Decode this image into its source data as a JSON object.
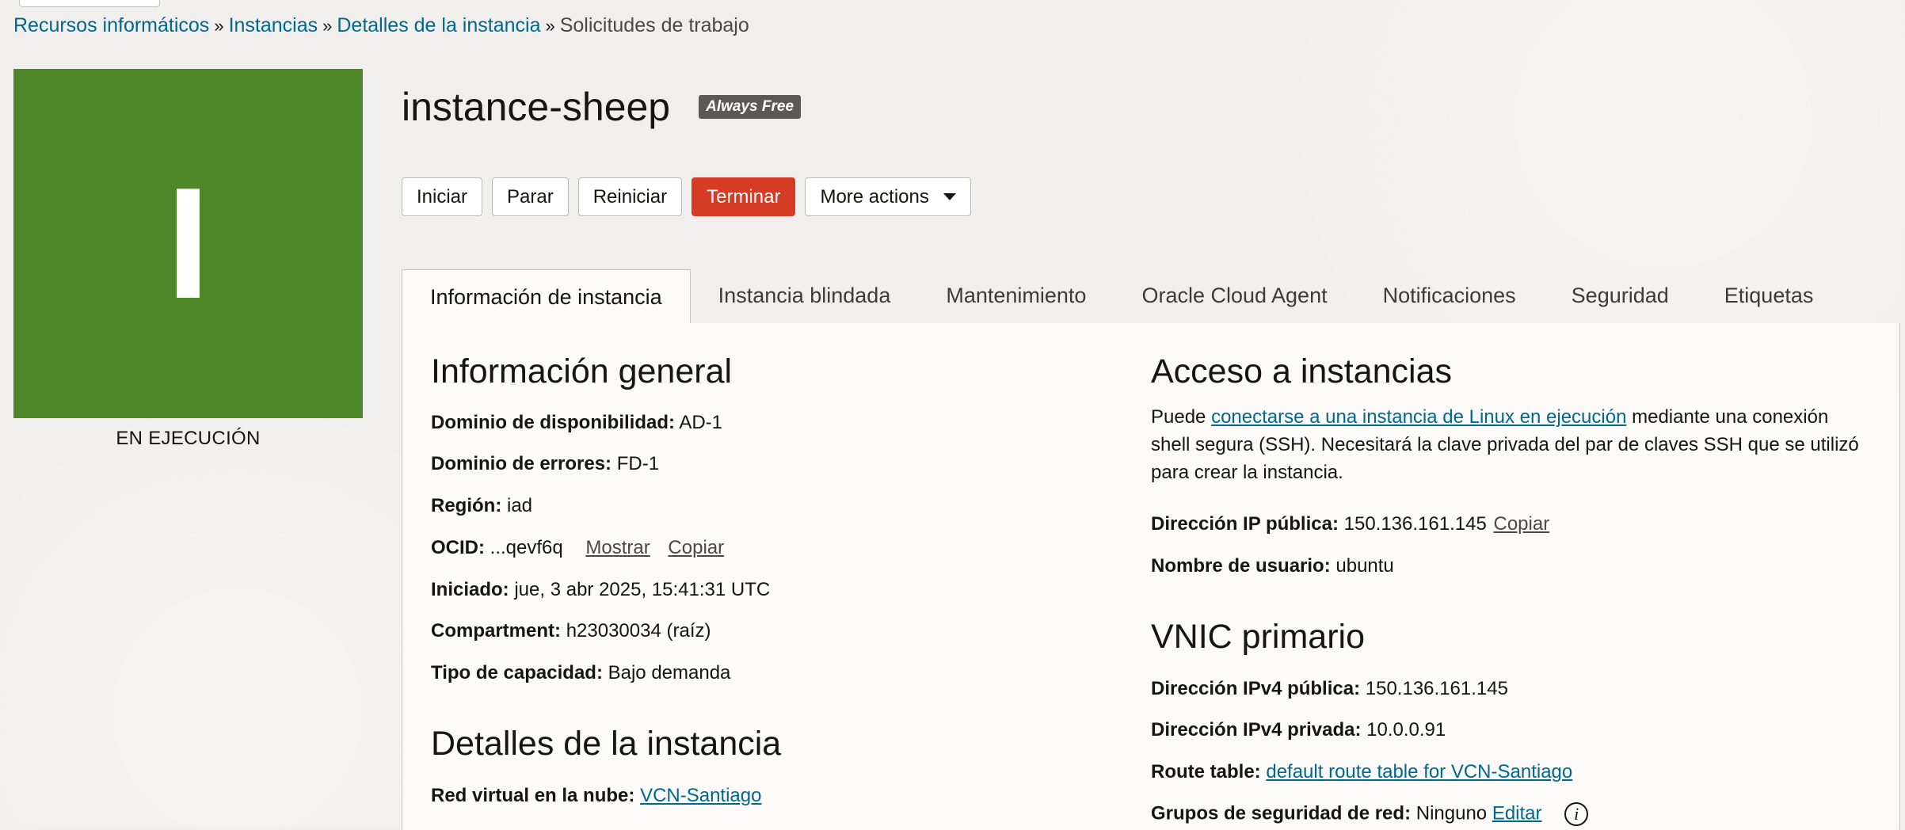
{
  "breadcrumb": {
    "items": [
      "Recursos informáticos",
      "Instancias",
      "Detalles de la instancia"
    ],
    "current": "Solicitudes de trabajo",
    "separator": "»"
  },
  "instance": {
    "tile_letter": "I",
    "tile_color": "#4e8628",
    "status": "EN EJECUCIÓN",
    "name": "instance-sheep",
    "badge": "Always Free"
  },
  "actions": {
    "start": "Iniciar",
    "stop": "Parar",
    "reboot": "Reiniciar",
    "terminate": "Terminar",
    "more": "More actions"
  },
  "tabs": [
    "Información de instancia",
    "Instancia blindada",
    "Mantenimiento",
    "Oracle Cloud Agent",
    "Notificaciones",
    "Seguridad",
    "Etiquetas"
  ],
  "general": {
    "heading": "Información general",
    "availability_label": "Dominio de disponibilidad:",
    "availability_value": "AD-1",
    "fault_label": "Dominio de errores:",
    "fault_value": "FD-1",
    "region_label": "Región:",
    "region_value": "iad",
    "ocid_label": "OCID:",
    "ocid_value": "...qevf6q",
    "ocid_show": "Mostrar",
    "ocid_copy": "Copiar",
    "launched_label": "Iniciado:",
    "launched_value": "jue, 3 abr 2025, 15:41:31 UTC",
    "compartment_label": "Compartment:",
    "compartment_value": "h23030034 (raíz)",
    "capacity_label": "Tipo de capacidad:",
    "capacity_value": "Bajo demanda"
  },
  "details": {
    "heading": "Detalles de la instancia",
    "vcn_label": "Red virtual en la nube:",
    "vcn_value": "VCN-Santiago"
  },
  "access": {
    "heading": "Acceso a instancias",
    "text_prefix": "Puede ",
    "text_link": "conectarse a una instancia de Linux en ejecución",
    "text_suffix": " mediante una conexión shell segura (SSH). Necesitará la clave privada del par de claves SSH que se utilizó para crear la instancia.",
    "public_ip_label": "Dirección IP pública:",
    "public_ip_value": "150.136.161.145",
    "copy": "Copiar",
    "username_label": "Nombre de usuario:",
    "username_value": "ubuntu"
  },
  "vnic": {
    "heading": "VNIC primario",
    "public_ipv4_label": "Dirección IPv4 pública:",
    "public_ipv4_value": "150.136.161.145",
    "private_ipv4_label": "Dirección IPv4 privada:",
    "private_ipv4_value": "10.0.0.91",
    "route_label": "Route table:",
    "route_value": "default route table for VCN-Santiago",
    "nsg_label": "Grupos de seguridad de red:",
    "nsg_value": "Ninguno",
    "nsg_edit": "Editar",
    "info_icon": "i"
  },
  "colors": {
    "link": "#00688c",
    "danger": "#d63b25",
    "background": "#f1efed",
    "panel": "#fbfaf8"
  }
}
